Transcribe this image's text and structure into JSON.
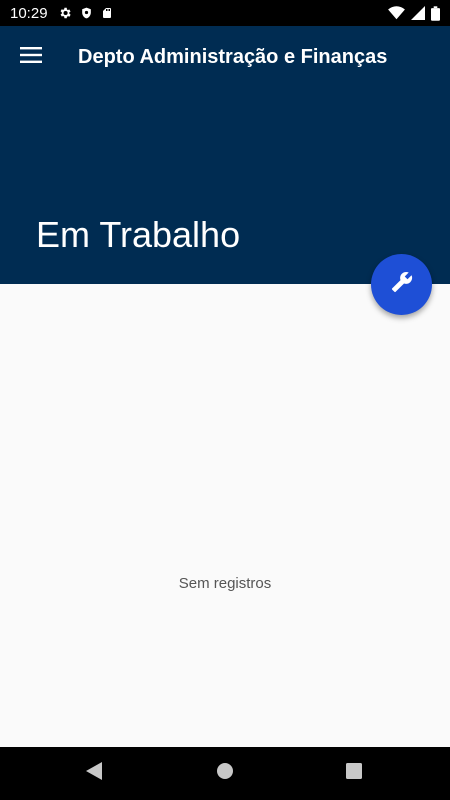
{
  "status_bar": {
    "time": "10:29",
    "icons": [
      "gear-icon",
      "shield-icon",
      "sd-card-icon",
      "wifi-icon",
      "signal-icon",
      "battery-icon"
    ]
  },
  "app_bar": {
    "title": "Depto Administração e Finanças",
    "section_title": "Em Trabalho",
    "menu_icon": "hamburger-menu-icon",
    "background_color": "#002c52"
  },
  "content": {
    "empty_message": "Sem registros"
  },
  "fab": {
    "icon": "wrench-icon",
    "color": "#1e4fd6"
  },
  "nav_bar": {
    "buttons": [
      "back-icon",
      "home-icon",
      "recents-icon"
    ]
  }
}
